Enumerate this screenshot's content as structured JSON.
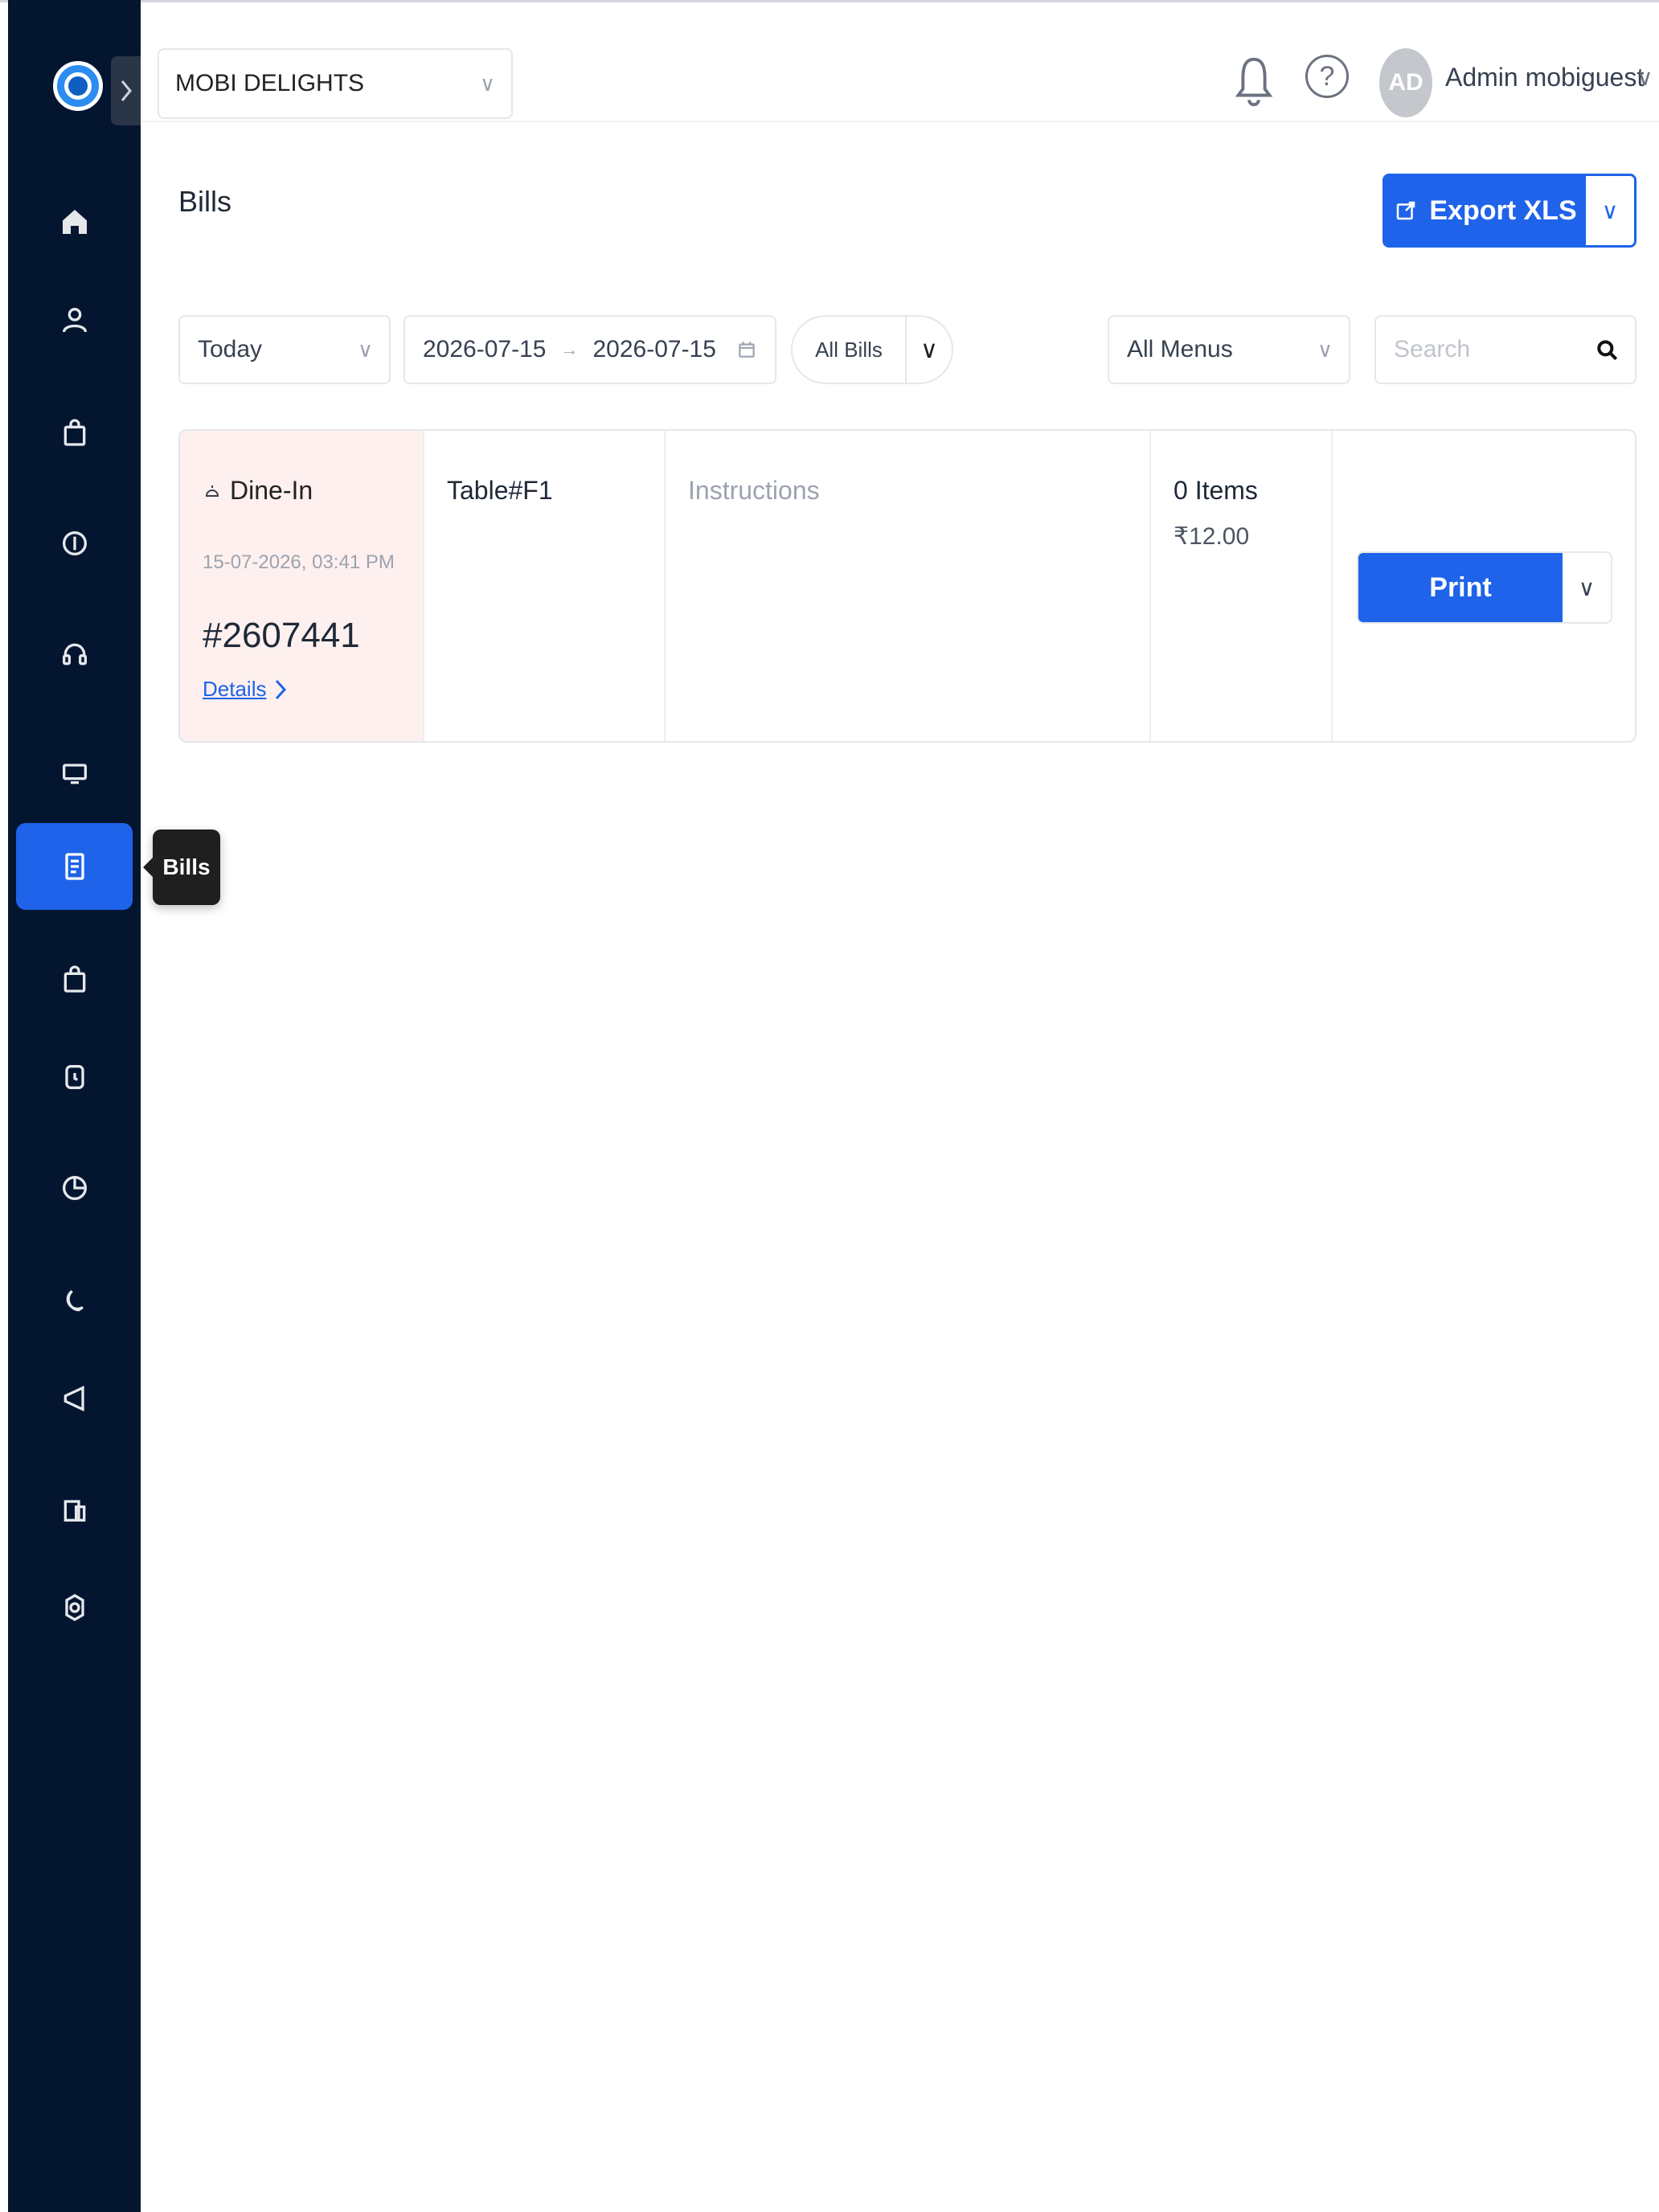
{
  "header": {
    "outlet": "MOBI DELIGHTS",
    "avatar_initials": "AD",
    "user_name": "Admin mobiguest",
    "help_symbol": "?"
  },
  "page": {
    "title": "Bills",
    "export_label": "Export XLS"
  },
  "filters": {
    "period": "Today",
    "date_from": "2026-07-15",
    "date_to": "2026-07-15",
    "bill_type": "All Bills",
    "menus": "All Menus",
    "search_placeholder": "Search"
  },
  "tooltip": "Bills",
  "bill": {
    "type": "Dine-In",
    "datetime": "15-07-2026, 03:41 PM",
    "number": "#2607441",
    "details_label": "Details",
    "table": "Table#F1",
    "instructions": "Instructions",
    "items": "0 Items",
    "amount": "₹12.00",
    "print_label": "Print"
  },
  "colors": {
    "sidebar_bg": "#041530",
    "accent": "#1e63e9",
    "bill_highlight": "#fdf0ef"
  },
  "sidebar_icons": [
    "home-icon",
    "user-icon",
    "bag-icon",
    "coin-icon",
    "headset-icon",
    "monitor-icon",
    "bill-icon",
    "bag-icon",
    "clock-icon",
    "pie-chart-icon",
    "moon-icon",
    "megaphone-icon",
    "building-icon",
    "settings-icon"
  ]
}
